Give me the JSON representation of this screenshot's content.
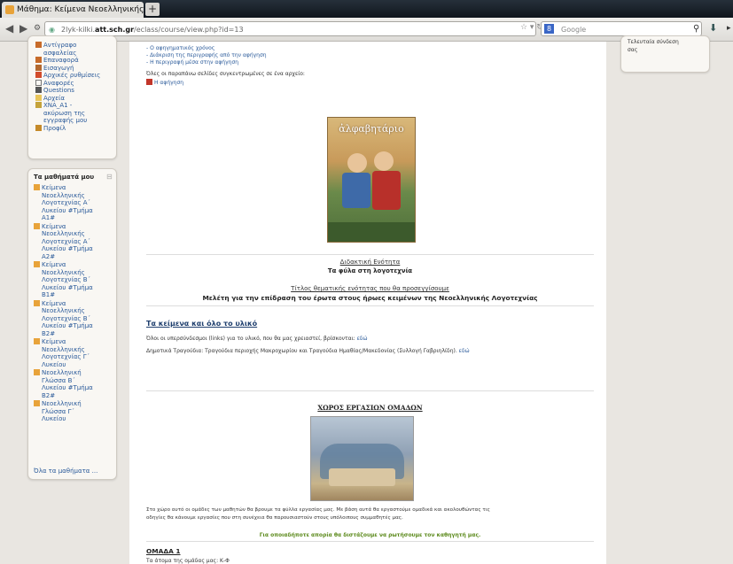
{
  "browser": {
    "tab_title": "Μάθημα: Κείμενα Νεοελληνικής Λογοτε...",
    "new_tab": "+",
    "url_prefix": "2lyk-kilki.",
    "url_host": "att.sch.gr",
    "url_path": "/eclass/course/view.php?id=13",
    "search_placeholder": "Google",
    "google_glyph": "8"
  },
  "left_block_top": {
    "items": [
      "Αντίγραφο",
      "ασφαλείας",
      "Επαναφορά",
      "Εισαγωγή",
      "Αρχικές ρυθμίσεις",
      "Αναφορές",
      "Questions",
      "Αρχεία",
      "ΧΝΑ_Α1 -",
      "ακύρωση της",
      "εγγραφής μου",
      "Προφίλ"
    ]
  },
  "courses_block": {
    "title": "Τα μαθήματά μου",
    "items": [
      [
        "Κείμενα",
        "Νεοελληνικής",
        "Λογοτεχνίας Α΄",
        "Λυκείου #Τμήμα",
        "Α1#"
      ],
      [
        "Κείμενα",
        "Νεοελληνικής",
        "Λογοτεχνίας Α΄",
        "Λυκείου #Τμήμα",
        "Α2#"
      ],
      [
        "Κείμενα",
        "Νεοελληνικής",
        "Λογοτεχνίας Β΄",
        "Λυκείου #Τμήμα",
        "Β1#"
      ],
      [
        "Κείμενα",
        "Νεοελληνικής",
        "Λογοτεχνίας Β΄",
        "Λυκείου #Τμήμα",
        "Β2#"
      ],
      [
        "Κείμενα",
        "Νεοελληνικής",
        "Λογοτεχνίας Γ΄",
        "Λυκείου"
      ],
      [
        "Νεοελληνική",
        "Γλώσσα Β΄",
        "Λυκείου #Τμήμα",
        "Β2#"
      ],
      [
        "Νεοελληνική",
        "Γλώσσα Γ΄",
        "Λυκείου"
      ]
    ],
    "all_courses": "Όλα τα μαθήματα ..."
  },
  "right_block": {
    "lines": [
      "Τελευταία σύνδεση",
      "σας"
    ]
  },
  "main": {
    "top_links": [
      "- Ο αφηγηματικός χρόνος",
      "- Διάκριση της περιγραφής από την αφήγηση",
      "- Η περιγραφή μέσα στην αφήγηση"
    ],
    "all_pages_text": "Όλες οι παραπάνω σελίδες συγκεντρωμένες σε ένα αρχείο:",
    "file_link": "Η αφήγηση",
    "cover_title": "ἀλφαβητάριο",
    "unit_label": "Διδακτική Ενότητα",
    "unit_title": "Τα φύλα στη λογοτεχνία",
    "theme_label": "Τίτλος θεματικής ενότητας που θα προσεγγίσουμε",
    "theme_title": "Μελέτη για την επίδραση του έρωτα στους ήρωες κειμένων της Νεοελληνικής Λογοτεχνίας",
    "texts_heading": "Τα κείμενα και όλο το υλικό",
    "links_line": "Όλοι οι υπερσύνδεσμοι (links) για το υλικό, που θα μας χρειαστεί, βρίσκονται:",
    "links_here": "εδώ",
    "songs_line": "Δημοτικά Τραγούδια: Τραγούδια περιοχής Μακροχωρίου και Τραγούδια Ημαθίας/Μακεδονίας (Συλλογή Γαβριηλίδη).",
    "songs_here": "εδώ",
    "groups_heading": "ΧΩΡΟΣ ΕΡΓΑΣΙΩΝ ΟΜΑΔΩΝ",
    "groups_p1": "Στο χώρο αυτό οι ομάδες των μαθητών θα βρουμε τα φύλλα εργασίας μας. Με βάση αυτά θα εργαστούμε ομαδικά και ακολουθώντας τις",
    "groups_p2": "οδηγίες θα κάνουμε εργασίες που στη συνέχεια θα παρουσιαστούν στους υπόλοιπους συμμαθητές μας.",
    "groups_note": "Για οποιαδήποτε απορία θα διστάζουμε να ρωτήσουμε τον καθηγητή μας.",
    "group1": "ΟΜΑΔΑ 1",
    "group1_sub": "Τα άτομα της ομάδας μας: Κ-Φ"
  },
  "colors": {
    "link": "#2a5a9a",
    "note_green": "#5c8a1c"
  }
}
